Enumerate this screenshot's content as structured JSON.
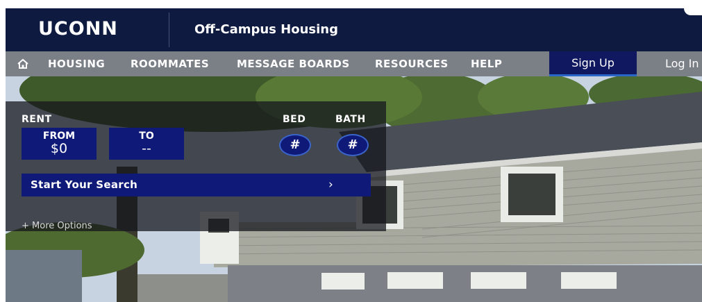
{
  "header": {
    "logo": "UCONN",
    "site_title": "Off-Campus Housing"
  },
  "nav": {
    "home_icon": "home-icon",
    "items": [
      "HOUSING",
      "ROOMMATES",
      "MESSAGE BOARDS",
      "RESOURCES",
      "HELP"
    ],
    "sign_up": "Sign Up",
    "log_in": "Log In"
  },
  "search": {
    "rent_label": "RENT",
    "from_label": "FROM",
    "from_value": "$0",
    "to_label": "TO",
    "to_value": "--",
    "bed_label": "BED",
    "bed_value": "#",
    "bath_label": "BATH",
    "bath_value": "#",
    "start_label": "Start Your Search",
    "start_arrow": "›",
    "more_options": "+ More Options"
  },
  "colors": {
    "header_bg": "#0e1a3f",
    "nav_bg": "#7b7f86",
    "accent": "#0f1a78",
    "accent_border": "#2a67c9"
  }
}
